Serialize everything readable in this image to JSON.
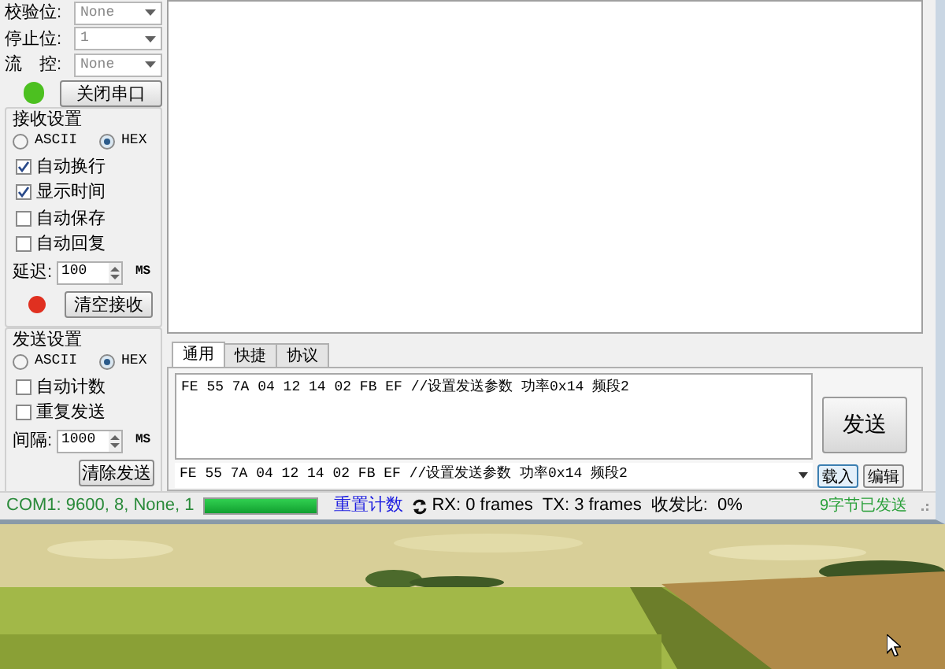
{
  "serial_settings": [
    {
      "label": "校验位:",
      "value": "None"
    },
    {
      "label": "停止位:",
      "value": "1"
    },
    {
      "label": "流　控:",
      "value": "None"
    }
  ],
  "port": {
    "open": true,
    "button": "关闭串口"
  },
  "receive_settings": {
    "title": "接收设置",
    "encodings": [
      {
        "label": "ASCII",
        "selected": false
      },
      {
        "label": "HEX",
        "selected": true
      }
    ],
    "options": [
      {
        "label": "自动换行",
        "checked": true
      },
      {
        "label": "显示时间",
        "checked": true
      },
      {
        "label": "自动保存",
        "checked": false
      },
      {
        "label": "自动回复",
        "checked": false
      }
    ],
    "delay": {
      "label": "延迟:",
      "value": "100",
      "unit": "MS"
    },
    "button": "清空接收"
  },
  "send_settings": {
    "title": "发送设置",
    "encodings": [
      {
        "label": "ASCII",
        "selected": false
      },
      {
        "label": "HEX",
        "selected": true
      }
    ],
    "options": [
      {
        "label": "自动计数",
        "checked": false
      },
      {
        "label": "重复发送",
        "checked": false
      }
    ],
    "interval": {
      "label": "间隔:",
      "value": "1000",
      "unit": "MS"
    },
    "button": "清除发送"
  },
  "tabs": [
    {
      "label": "通用",
      "selected": true
    },
    {
      "label": "快捷",
      "selected": false
    },
    {
      "label": "协议",
      "selected": false
    }
  ],
  "send_text": "FE 55 7A 04 12 14 02 FB EF //设置发送参数 功率0x14 频段2",
  "send_button": "发送",
  "history": {
    "value": "FE 55 7A 04 12 14 02 FB EF //设置发送参数 功率0x14 频段2"
  },
  "history_buttons": [
    "载入",
    "编辑"
  ],
  "status_bar": {
    "port": "COM1: 9600, 8, None, 1",
    "progress": {
      "level": 1
    },
    "reset": "重置计数",
    "rx": "RX: 0 frames",
    "tx": "TX: 3 frames",
    "ratio": "收发比:  0%",
    "sent": "9字节已发送"
  }
}
